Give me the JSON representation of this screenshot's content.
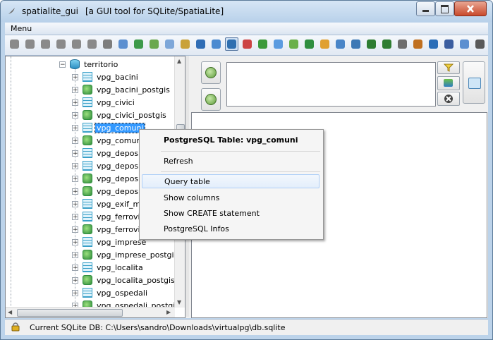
{
  "window": {
    "app_name": "spatialite_gui",
    "subtitle": "[a GUI tool for SQLite/SpatiaLite]"
  },
  "menu": {
    "label": "Menu"
  },
  "toolbar": {
    "icons": [
      "connect-icon",
      "disconnect-icon",
      "create-db-icon",
      "memory-db-icon",
      "memory-db-load-icon",
      "memory-db-save-icon",
      "vacuum-icon",
      "sql-script-icon",
      "load-shapefile-icon",
      "virtual-shapefile-icon",
      "load-dbf-icon",
      "virtual-csv-icon",
      "query-view-composer-icon",
      "map-icon",
      "attach-icon",
      "sql-log-icon",
      "dump-icon",
      "export-icon",
      "export-dxf-icon",
      "load-xl-icon",
      "virtual-xl-icon",
      "network-icon",
      "exif-icon",
      "gps-icon",
      "wfs-icon",
      "xml-icon",
      "srids-icon",
      "charset-icon",
      "about-icon",
      "help-icon",
      "exit-icon"
    ],
    "active_index": 14
  },
  "tree": {
    "root_label": "territorio",
    "items": [
      {
        "label": "vpg_bacini",
        "kind": "table"
      },
      {
        "label": "vpg_bacini_postgis",
        "kind": "geo"
      },
      {
        "label": "vpg_civici",
        "kind": "table"
      },
      {
        "label": "vpg_civici_postgis",
        "kind": "geo"
      },
      {
        "label": "vpg_comuni",
        "kind": "table",
        "selected": true
      },
      {
        "label": "vpg_comuni",
        "kind": "geo"
      },
      {
        "label": "vpg_depos",
        "kind": "table"
      },
      {
        "label": "vpg_depos",
        "kind": "table"
      },
      {
        "label": "vpg_depos",
        "kind": "geo"
      },
      {
        "label": "vpg_depos",
        "kind": "geo"
      },
      {
        "label": "vpg_exif_m",
        "kind": "table"
      },
      {
        "label": "vpg_ferrovi",
        "kind": "table"
      },
      {
        "label": "vpg_ferrovi",
        "kind": "geo"
      },
      {
        "label": "vpg_imprese",
        "kind": "table"
      },
      {
        "label": "vpg_imprese_postgi",
        "kind": "geo"
      },
      {
        "label": "vpg_localita",
        "kind": "table"
      },
      {
        "label": "vpg_localita_postgis",
        "kind": "geo"
      },
      {
        "label": "vpg_ospedali",
        "kind": "table"
      },
      {
        "label": "vpg_ospedali_postgis",
        "kind": "geo"
      }
    ]
  },
  "context_menu": {
    "header": "PostgreSQL Table: vpg_comuni",
    "refresh": "Refresh",
    "query_table": "Query table",
    "show_columns": "Show columns",
    "show_create": "Show CREATE statement",
    "pg_infos": "PostgreSQL Infos"
  },
  "status": {
    "text": "Current SQLite DB: C:\\Users\\sandro\\Downloads\\virtualpg\\db.sqlite"
  },
  "colors": {
    "selection": "#3399ff",
    "window_frame": "#bcd3ea",
    "close_button": "#c94a2c"
  }
}
